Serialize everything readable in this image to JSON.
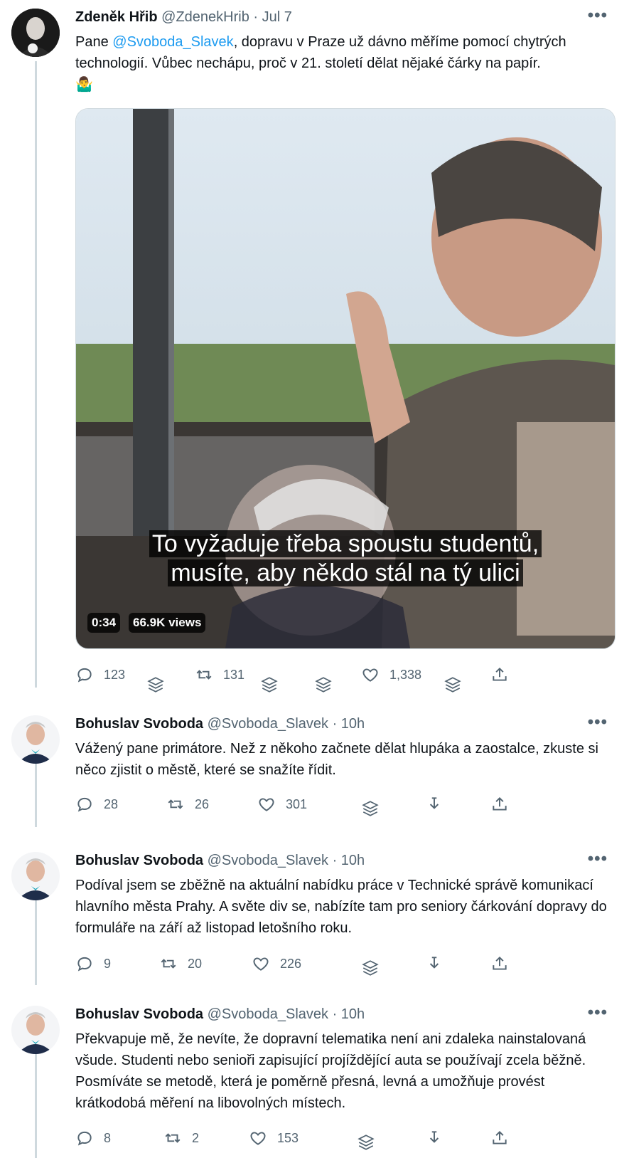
{
  "tweets": [
    {
      "name": "Zdeněk Hřib",
      "handle": "@ZdenekHrib",
      "time": "· Jul 7",
      "text_prefix": "Pane ",
      "mention": "@Svoboda_Slavek",
      "text_suffix": ", dopravu v Praze už dávno měříme pomocí chytrých technologií. Vůbec nechápu, proč v 21. století dělat nějaké čárky na papír.",
      "emoji": "🤷‍♂️",
      "video": {
        "subtitle_line1": "To vyžaduje třeba spoustu studentů,",
        "subtitle_line2": "musíte, aby někdo stál na tý ulici",
        "duration": "0:34",
        "views": "66.9K views"
      },
      "replies": "123",
      "retweets": "131",
      "likes": "1,338"
    },
    {
      "name": "Bohuslav Svoboda",
      "handle": "@Svoboda_Slavek",
      "time": "· 10h",
      "text": "Vážený pane primátore. Než z někoho začnete dělat hlupáka a zaostalce, zkuste si něco zjistit o městě, které se snažíte řídit.",
      "replies": "28",
      "retweets": "26",
      "likes": "301"
    },
    {
      "name": "Bohuslav Svoboda",
      "handle": "@Svoboda_Slavek",
      "time": "· 10h",
      "text": "Podíval jsem se zběžně na aktuální nabídku práce v Technické správě komunikací hlavního města Prahy. A světe div se, nabízíte tam pro seniory čárkování dopravy do formuláře na září až listopad letošního roku.",
      "replies": "9",
      "retweets": "20",
      "likes": "226"
    },
    {
      "name": "Bohuslav Svoboda",
      "handle": "@Svoboda_Slavek",
      "time": "· 10h",
      "text": "Překvapuje mě, že nevíte, že dopravní telematika není ani zdaleka nainstalovaná všude. Studenti nebo senioři zapisující projíždějící auta se používají zcela běžně. Posmíváte se metodě, která je poměrně přesná, levná a umožňuje provést krátkodobá měření na libovolných místech.",
      "replies": "8",
      "retweets": "2",
      "likes": "153"
    }
  ],
  "more_label": "•••",
  "colors": {
    "link": "#1d9bf0",
    "muted": "#536471",
    "thread": "#cfd9de"
  }
}
